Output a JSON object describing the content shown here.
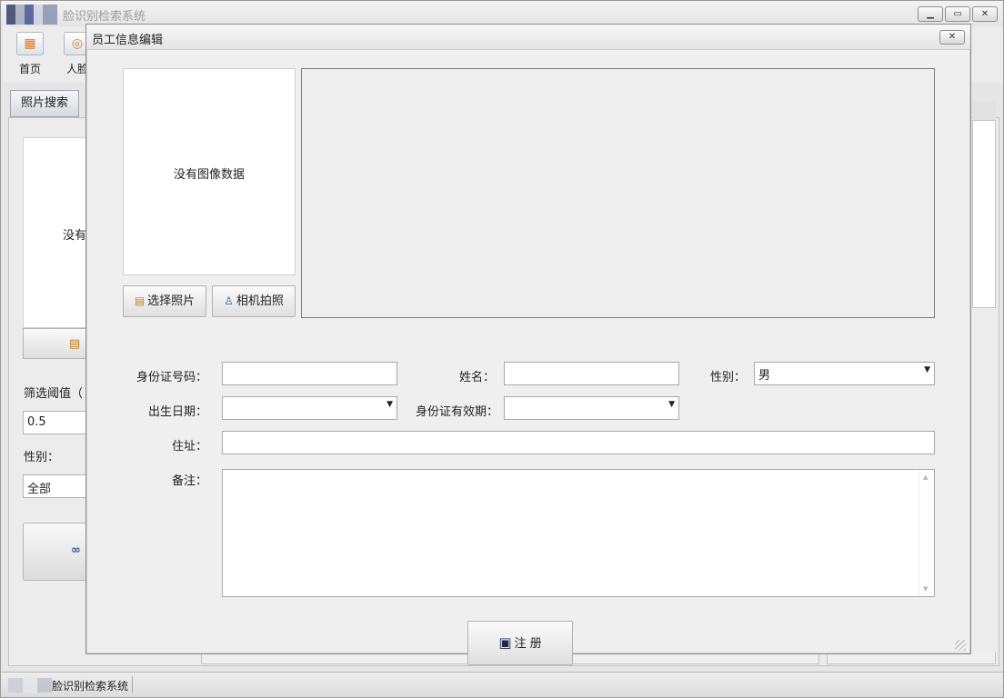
{
  "main_window": {
    "title": "脸识别检索系统",
    "controls": {
      "minimize": "▁",
      "maximize": "▭",
      "close": "✕"
    },
    "toolbar": [
      {
        "label": "首页",
        "icon": "home-icon"
      },
      {
        "label": "人脸",
        "icon": "face-icon"
      }
    ],
    "tab": "照片搜索",
    "background_form": {
      "no_image_text": "没有",
      "threshold_label": "筛选阈值（",
      "threshold_value": "0.5",
      "gender_label": "性别：",
      "gender_value": "全部"
    },
    "statusbar_text": "脸识别检索系统"
  },
  "dialog": {
    "title": "员工信息编辑",
    "close": "✕",
    "photo_placeholder": "没有图像数据",
    "buttons": {
      "select_photo": "选择照片",
      "camera_capture": "相机拍照",
      "register": "注 册"
    },
    "form": {
      "id_number_label": "身份证号码：",
      "id_number_value": "",
      "name_label": "姓名：",
      "name_value": "",
      "gender_label": "性别：",
      "gender_value": "男",
      "birth_date_label": "出生日期：",
      "birth_date_value": "",
      "id_validity_label": "身份证有效期：",
      "id_validity_value": "",
      "address_label": "住址：",
      "address_value": "",
      "remarks_label": "备注：",
      "remarks_value": ""
    }
  }
}
